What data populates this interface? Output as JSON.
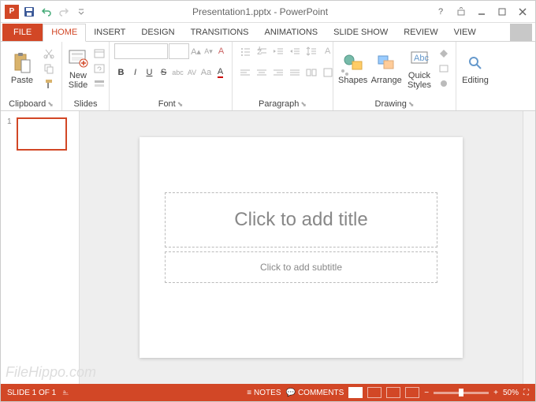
{
  "title": "Presentation1.pptx - PowerPoint",
  "tabs": {
    "file": "FILE",
    "home": "HOME",
    "insert": "INSERT",
    "design": "DESIGN",
    "transitions": "TRANSITIONS",
    "animations": "ANIMATIONS",
    "slideshow": "SLIDE SHOW",
    "review": "REVIEW",
    "view": "VIEW"
  },
  "ribbon": {
    "clipboard": {
      "label": "Clipboard",
      "paste": "Paste"
    },
    "slides": {
      "label": "Slides",
      "new_slide": "New\nSlide"
    },
    "font": {
      "label": "Font"
    },
    "paragraph": {
      "label": "Paragraph"
    },
    "drawing": {
      "label": "Drawing",
      "shapes": "Shapes",
      "arrange": "Arrange",
      "quick_styles": "Quick\nStyles"
    },
    "editing": {
      "label": "Editing",
      "editing": "Editing"
    }
  },
  "slide": {
    "number": "1",
    "title_placeholder": "Click to add title",
    "subtitle_placeholder": "Click to add subtitle"
  },
  "status": {
    "slide_count": "SLIDE 1 OF 1",
    "notes": "NOTES",
    "comments": "COMMENTS",
    "zoom": "50%"
  },
  "watermark": "FileHippo.com"
}
